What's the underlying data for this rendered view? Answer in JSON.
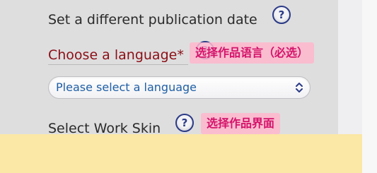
{
  "form": {
    "publication_date_label": "Set a different publication date",
    "language_label": "Choose a language*",
    "language_select": {
      "selected": "Please select a language"
    },
    "work_skin_label": "Select Work Skin",
    "help_glyph": "?"
  },
  "annotations": {
    "language_note": "选择作品语言（必选）",
    "work_skin_note": "选择作品界面"
  },
  "colors": {
    "panel": "#dededf",
    "required_label": "#8b0f16",
    "select_text": "#1f5fa6",
    "annotation_bg": "#ffb7ce",
    "annotation_text": "#d4136a",
    "bottom_overlay": "#fbe7a6"
  },
  "icons": {
    "help": "question-circle-icon",
    "select_arrows": "chevron-up-down-icon"
  }
}
